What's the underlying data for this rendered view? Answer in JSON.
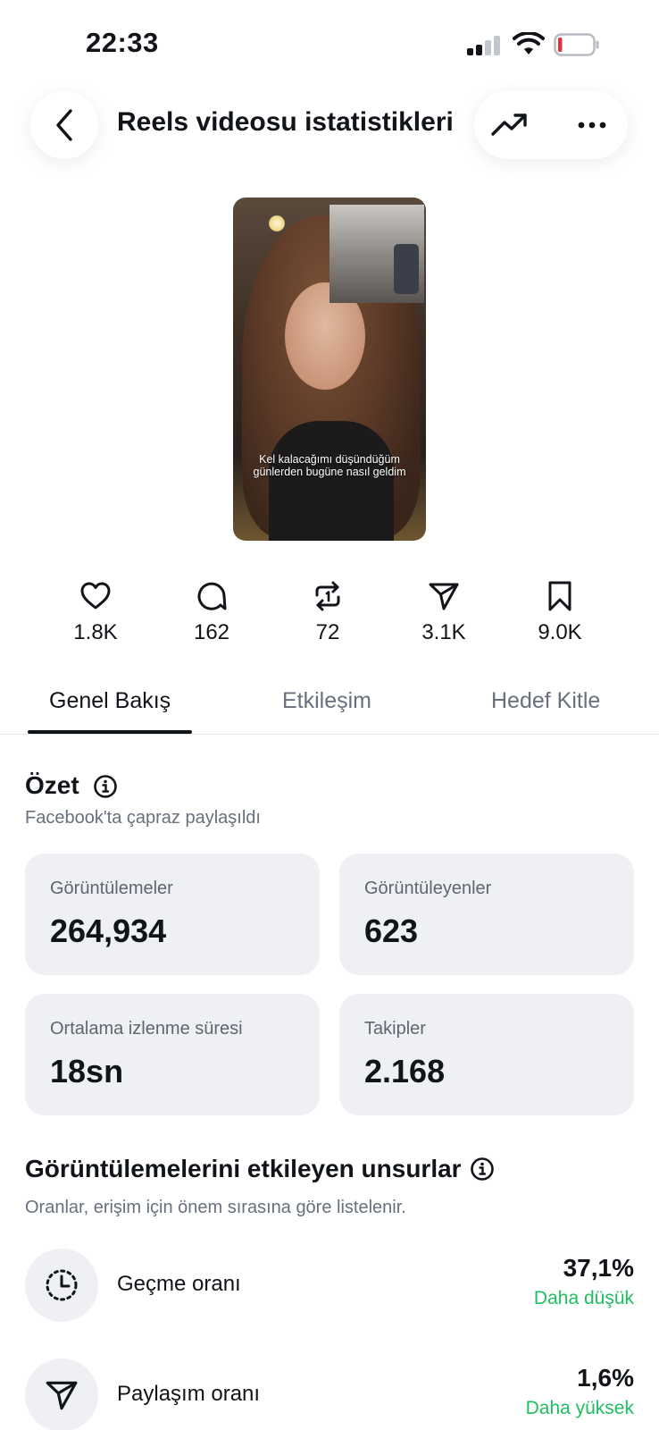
{
  "status_bar": {
    "time": "22:33",
    "battery_color": "#e5303a"
  },
  "header": {
    "title": "Reels videosu istatistikleri",
    "back_icon": "chevron-left-icon",
    "trend_icon": "trending-up-icon",
    "more_icon": "more-horizontal-icon"
  },
  "thumbnail": {
    "caption_line1": "Kel kalacağımı düşündüğüm",
    "caption_line2": "günlerden bugüne nasıl geldim"
  },
  "metrics": [
    {
      "icon": "heart-icon",
      "value": "1.8K"
    },
    {
      "icon": "comment-icon",
      "value": "162"
    },
    {
      "icon": "repost-icon",
      "value": "72"
    },
    {
      "icon": "share-icon",
      "value": "3.1K"
    },
    {
      "icon": "bookmark-icon",
      "value": "9.0K"
    }
  ],
  "tabs": [
    {
      "label": "Genel Bakış",
      "active": true
    },
    {
      "label": "Etkileşim",
      "active": false
    },
    {
      "label": "Hedef Kitle",
      "active": false
    }
  ],
  "summary": {
    "title": "Özet",
    "subtitle": "Facebook'ta çapraz paylaşıldı",
    "cards": [
      {
        "label": "Görüntülemeler",
        "value": "264,934"
      },
      {
        "label": "Görüntüleyenler",
        "value": "623"
      },
      {
        "label": "Ortalama izlenme süresi",
        "value": "18sn"
      },
      {
        "label": "Takipler",
        "value": "2.168"
      }
    ]
  },
  "factors": {
    "title": "Görüntülemelerini etkileyen unsurlar",
    "subtitle": "Oranlar, erişim için önem sırasına göre listelenir.",
    "items": [
      {
        "icon": "timer-icon",
        "label": "Geçme oranı",
        "value": "37,1%",
        "note": "Daha düşük"
      },
      {
        "icon": "share-icon",
        "label": "Paylaşım oranı",
        "value": "1,6%",
        "note": "Daha yüksek"
      }
    ],
    "note_color": "#1fbf5f"
  }
}
